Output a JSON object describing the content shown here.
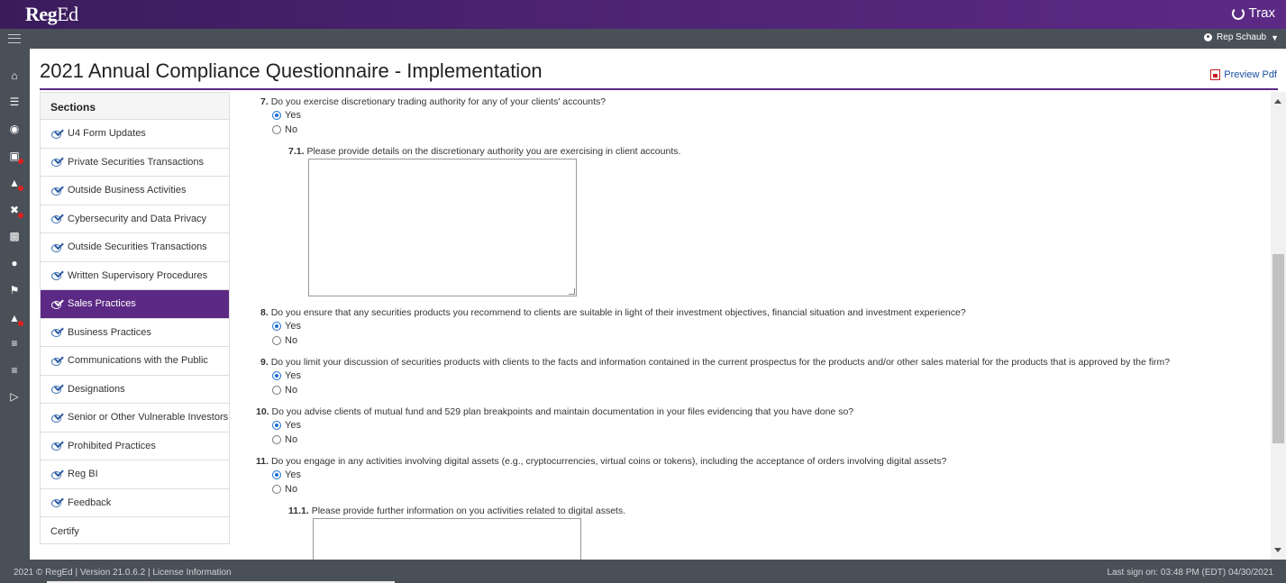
{
  "header": {
    "logo_reg": "Reg",
    "logo_ed": "Ed",
    "trax_label": "Trax",
    "user_name": "Rep Schaub"
  },
  "page": {
    "title": "2021 Annual Compliance Questionnaire - Implementation",
    "preview_label": "Preview Pdf"
  },
  "nav_icons": [
    "home-icon",
    "list-icon",
    "dashboard-icon",
    "document-icon",
    "graduation-cap-icon",
    "shuffle-icon",
    "id-card-icon",
    "user-icon",
    "flag-icon",
    "graduation-cap-icon",
    "list-icon",
    "list-icon",
    "binoculars-icon"
  ],
  "sections": {
    "header": "Sections",
    "items": [
      {
        "label": "U4 Form Updates"
      },
      {
        "label": "Private Securities Transactions"
      },
      {
        "label": "Outside Business Activities"
      },
      {
        "label": "Cybersecurity and Data Privacy"
      },
      {
        "label": "Outside Securities Transactions"
      },
      {
        "label": "Written Supervisory Procedures"
      },
      {
        "label": "Sales Practices"
      },
      {
        "label": "Business Practices"
      },
      {
        "label": "Communications with the Public"
      },
      {
        "label": "Designations"
      },
      {
        "label": "Senior or Other Vulnerable Investors"
      },
      {
        "label": "Prohibited Practices"
      },
      {
        "label": "Reg BI"
      },
      {
        "label": "Feedback"
      },
      {
        "label": "Certify"
      }
    ]
  },
  "questions": {
    "q7": {
      "num": "7.",
      "text": "Do you exercise discretionary trading authority for any of your clients' accounts?",
      "selected": "Yes"
    },
    "q7_1": {
      "num": "7.1.",
      "text": "Please provide details on the discretionary authority you are exercising in client accounts.",
      "value": ""
    },
    "q8": {
      "num": "8.",
      "text": "Do you ensure that any securities products you recommend to clients are suitable in light of their investment objectives, financial situation and investment experience?",
      "selected": "Yes"
    },
    "q9": {
      "num": "9.",
      "text": "Do you limit your discussion of securities products with clients to the facts and information contained in the current prospectus for the products and/or other sales material for the products that is approved by the firm?",
      "selected": "Yes"
    },
    "q10": {
      "num": "10.",
      "text": "Do you advise clients of mutual fund and 529 plan breakpoints and maintain documentation in your files evidencing that you have done so?",
      "selected": "Yes"
    },
    "q11": {
      "num": "11.",
      "text": "Do you engage in any activities involving digital assets (e.g., cryptocurrencies, virtual coins or tokens), including the acceptance of orders involving digital assets?",
      "selected": "Yes"
    },
    "q11_1": {
      "num": "11.1.",
      "text": "Please provide further information on you activities related to digital assets.",
      "value": ""
    },
    "yes_label": "Yes",
    "no_label": "No"
  },
  "footer": {
    "left": "2021 © RegEd | Version 21.0.6.2 | License Information",
    "right": "Last sign on: 03:48 PM (EDT) 04/30/2021"
  },
  "colors": {
    "brand_purple": "#5c2a85",
    "chrome_gray": "#4a5058",
    "link_blue": "#1a4fa0",
    "radio_blue": "#1a6fd6"
  }
}
